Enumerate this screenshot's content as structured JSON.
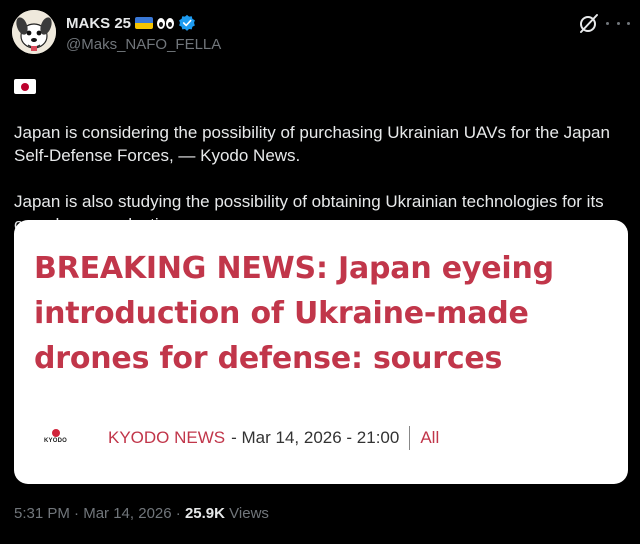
{
  "author": {
    "display_name": "MAKS 25",
    "handle": "@Maks_NAFO_FELLA",
    "avatar_icon": "cartoon-dog-avatar",
    "verified": true
  },
  "tweet": {
    "paragraph1": "Japan is considering the possibility of purchasing Ukrainian UAVs for the Japan Self-Defense Forces, — Kyodo News.",
    "paragraph2": "Japan is also studying the possibility of obtaining Ukrainian technologies for its own drone production."
  },
  "card": {
    "headline": "BREAKING NEWS: Japan eyeing introduction of Ukraine-made drones for defense: sources",
    "logo_text": "KYODO",
    "source_name": "KYODO NEWS",
    "source_meta": "- Mar 14, 2026 - 21:00",
    "all_link": "All"
  },
  "footer": {
    "time": "5:31 PM",
    "separator": "·",
    "date": "Mar 14, 2026",
    "views_count": "25.9K",
    "views_label": "Views"
  },
  "colors": {
    "background": "#000000",
    "headline_red": "#c1364a",
    "muted_text": "#71767b",
    "verified_blue": "#1d9bf0"
  }
}
